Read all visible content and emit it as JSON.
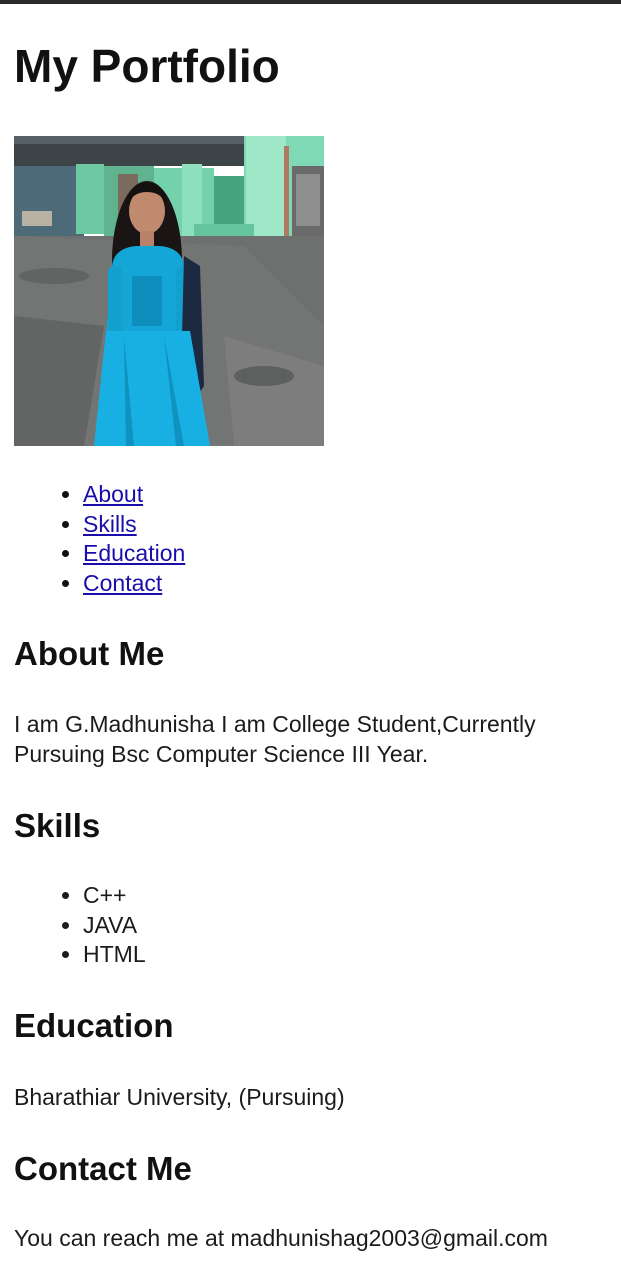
{
  "page": {
    "title": "My Portfolio"
  },
  "profile_photo": {
    "alt": "Portrait photo",
    "colors": {
      "dress": "#16a8d8",
      "wall": "#6fd3a8",
      "ground": "#6d6d6d"
    }
  },
  "nav": {
    "items": [
      {
        "label": "About"
      },
      {
        "label": "Skills"
      },
      {
        "label": "Education"
      },
      {
        "label": "Contact"
      }
    ],
    "link_color": "#1a0dab"
  },
  "about": {
    "heading": "About Me",
    "text": "I am G.Madhunisha I am College Student,Currently Pursuing Bsc Computer Science III Year."
  },
  "skills": {
    "heading": "Skills",
    "items": [
      "C++",
      "JAVA",
      "HTML"
    ]
  },
  "education": {
    "heading": "Education",
    "text": "Bharathiar University, (Pursuing)"
  },
  "contact": {
    "heading": "Contact Me",
    "text": "You can reach me at madhunishag2003@gmail.com"
  }
}
